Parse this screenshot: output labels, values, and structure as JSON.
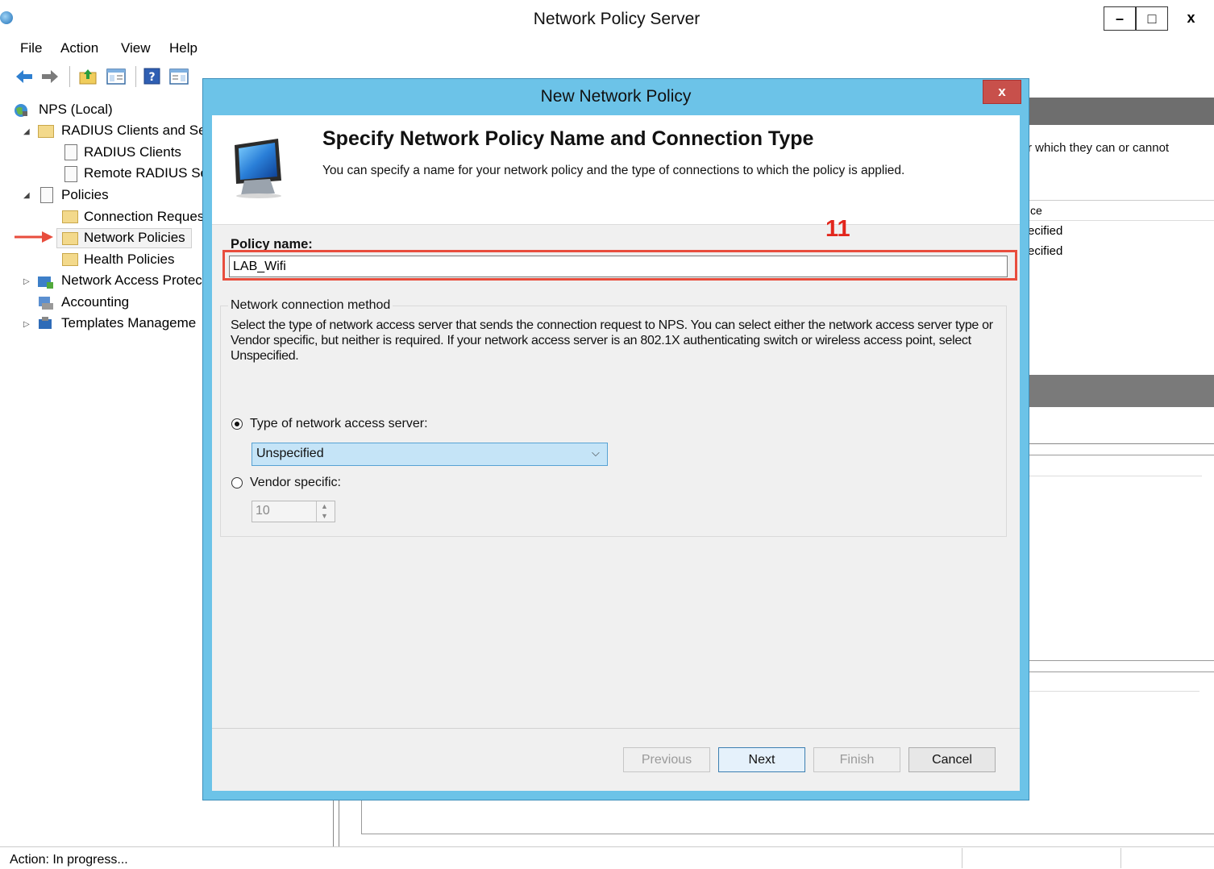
{
  "window": {
    "title": "Network Policy Server",
    "minimize_label": "–",
    "restore_label": "□",
    "close_label": "x"
  },
  "menu": [
    "File",
    "Action",
    "View",
    "Help"
  ],
  "toolbar_icons": [
    "back-arrow-icon",
    "forward-arrow-icon",
    "up-folder-icon",
    "show-hide-console-tree-icon",
    "help-icon",
    "show-hide-action-pane-icon"
  ],
  "tree": {
    "root": "NPS (Local)",
    "radius_clients_servers": "RADIUS Clients and Se",
    "radius_clients": "RADIUS Clients",
    "remote_radius": "Remote RADIUS Se",
    "policies": "Policies",
    "connection_request": "Connection Reques",
    "network_policies": "Network Policies",
    "health_policies": "Health Policies",
    "network_access_protection": "Network Access Protec",
    "accounting": "Accounting",
    "templates": "Templates Manageme"
  },
  "right_pane": {
    "desc_fragment": "r which they can or cannot",
    "col_fragment": "ce",
    "row1": "ecified",
    "row2": "ecified"
  },
  "status": {
    "text": "Action:  In progress..."
  },
  "dialog": {
    "title": "New Network Policy",
    "close_label": "x",
    "heading": "Specify Network Policy Name and Connection Type",
    "subheading": "You can specify a name for your network policy and the type of connections to which the policy is applied.",
    "annotation_number": "11",
    "policy_name_label": "Policy name:",
    "policy_name_value": "LAB_Wifi",
    "group_title": "Network connection method",
    "group_description": "Select the type of network access server that sends the connection request to NPS. You can select either the network access server type or Vendor specific, but neither is required.  If your network access server is an 802.1X authenticating switch or wireless access point, select Unspecified.",
    "option_type_label": "Type of network access server:",
    "option_type_selected": true,
    "type_select_value": "Unspecified",
    "option_vendor_label": "Vendor specific:",
    "option_vendor_selected": false,
    "vendor_value": "10",
    "buttons": {
      "previous": "Previous",
      "next": "Next",
      "finish": "Finish",
      "cancel": "Cancel"
    }
  },
  "colors": {
    "dialog_frame": "#6cc3e8",
    "dialog_close": "#c8504b",
    "annotation_red": "#e2261c",
    "select_highlight": "#c5e4f7"
  }
}
